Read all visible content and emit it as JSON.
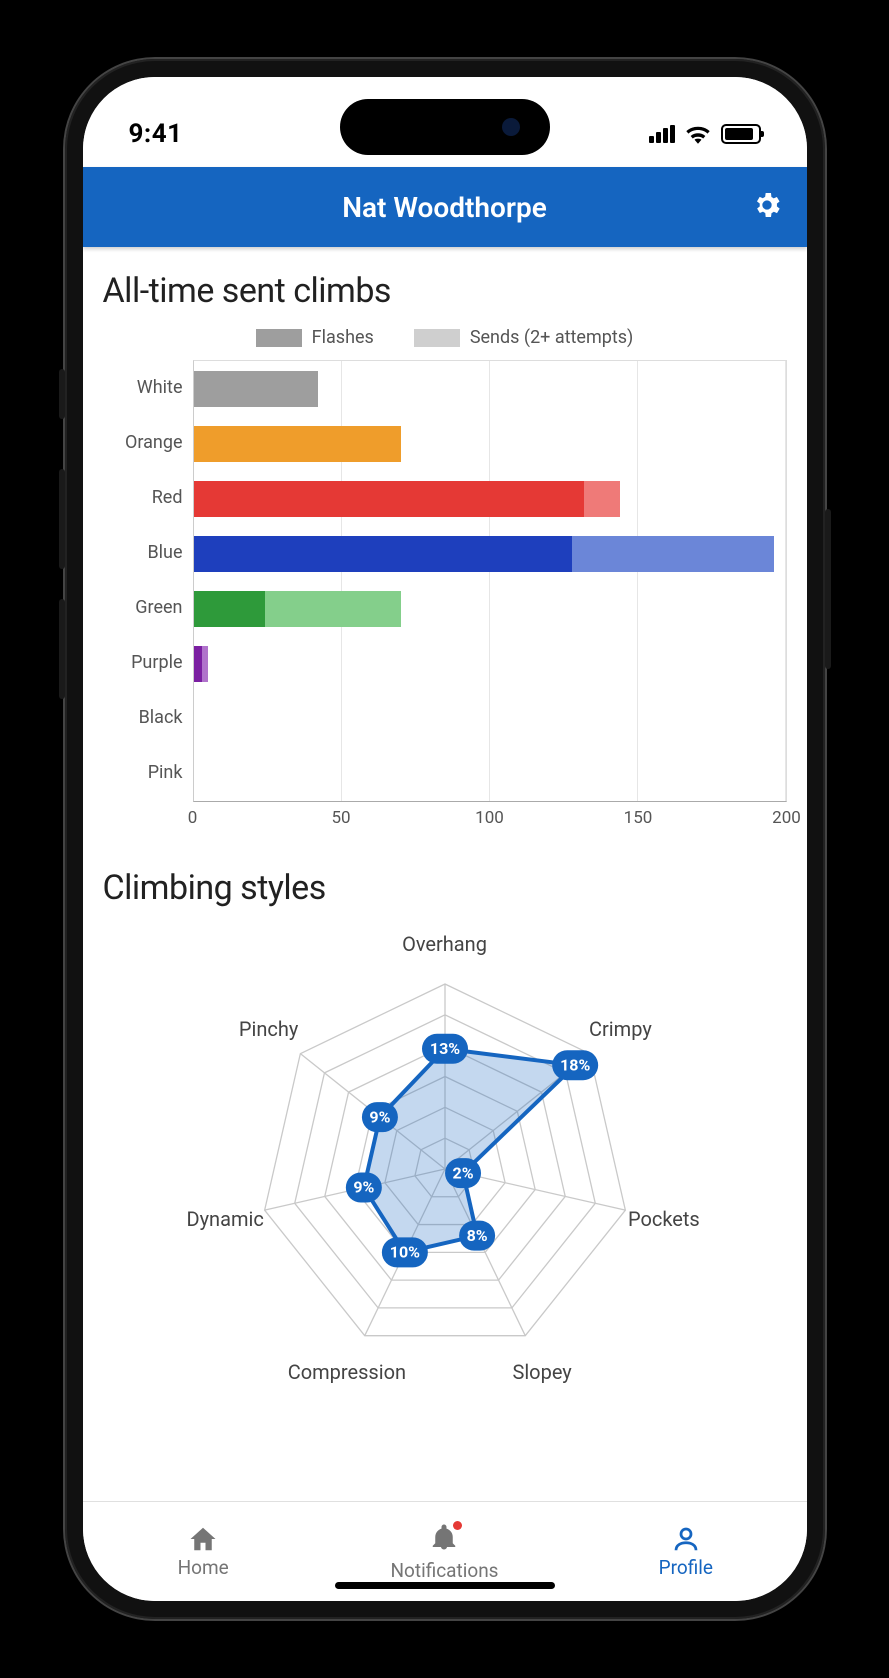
{
  "status": {
    "time": "9:41"
  },
  "appbar": {
    "title": "Nat Woodthorpe"
  },
  "sections": {
    "sent_climbs_title": "All-time sent climbs",
    "styles_title": "Climbing styles"
  },
  "legend": {
    "flashes": "Flashes",
    "sends": "Sends (2+ attempts)"
  },
  "xaxis": {
    "t0": "0",
    "t1": "50",
    "t2": "100",
    "t3": "150",
    "t4": "200"
  },
  "tabs": {
    "home": "Home",
    "notifications": "Notifications",
    "profile": "Profile"
  },
  "chart_data": [
    {
      "type": "bar",
      "orientation": "horizontal",
      "title": "All-time sent climbs",
      "xlabel": "",
      "ylabel": "",
      "xlim": [
        0,
        200
      ],
      "xticks": [
        0,
        50,
        100,
        150,
        200
      ],
      "stacked": true,
      "categories": [
        "White",
        "Orange",
        "Red",
        "Blue",
        "Green",
        "Purple",
        "Black",
        "Pink"
      ],
      "series": [
        {
          "name": "Flashes",
          "values": [
            42,
            70,
            132,
            128,
            24,
            3,
            0,
            0
          ]
        },
        {
          "name": "Sends (2+ attempts)",
          "values": [
            0,
            0,
            12,
            68,
            46,
            2,
            0,
            0
          ]
        }
      ],
      "bar_colors": {
        "White": {
          "flash": "#9e9e9e",
          "sends": "#cfcfcf"
        },
        "Orange": {
          "flash": "#ef9d2b",
          "sends": "#f5c182"
        },
        "Red": {
          "flash": "#e53935",
          "sends": "#ef7a78"
        },
        "Blue": {
          "flash": "#1e3fbd",
          "sends": "#6b86d8"
        },
        "Green": {
          "flash": "#2e9a3a",
          "sends": "#84cf8b"
        },
        "Purple": {
          "flash": "#7b1fa2",
          "sends": "#b073cb"
        },
        "Black": {
          "flash": "#000000",
          "sends": "#666666"
        },
        "Pink": {
          "flash": "#e91e63",
          "sends": "#f48fb1"
        }
      },
      "legend_colors": {
        "Flashes": "#9e9e9e",
        "Sends (2+ attempts)": "#cfcfcf"
      }
    },
    {
      "type": "radar",
      "title": "Climbing styles",
      "categories": [
        "Overhang",
        "Crimpy",
        "Pockets",
        "Slopey",
        "Compression",
        "Dynamic",
        "Pinchy"
      ],
      "values_percent": [
        13,
        18,
        2,
        8,
        10,
        9,
        9
      ],
      "value_suffix": "%",
      "rings": 6,
      "fill_color": "#1565C0",
      "fill_opacity": 0.25,
      "stroke_color": "#1565C0"
    }
  ]
}
